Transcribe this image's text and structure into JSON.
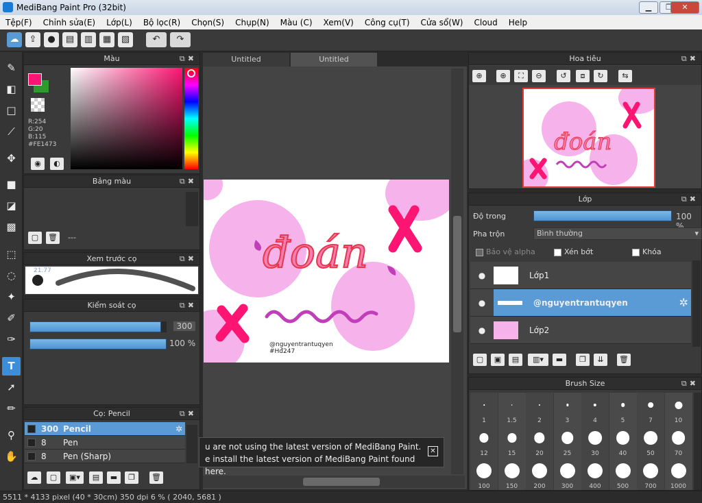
{
  "window": {
    "title": "MediBang Paint Pro (32bit)",
    "min": "▁",
    "max": "❐",
    "close": "✕"
  },
  "menu": [
    "Tệp(F)",
    "Chỉnh sửa(E)",
    "Lớp(L)",
    "Bộ lọc(R)",
    "Chọn(S)",
    "Chụp(N)",
    "Màu (C)",
    "Xem(V)",
    "Công cụ(T)",
    "Cửa sổ(W)",
    "Cloud",
    "Help"
  ],
  "color_panel": {
    "title": "Màu",
    "r": "R:254",
    "g": "G:20",
    "b": "B:115",
    "hex": "#FE1473",
    "fg": "#FE1473",
    "bg": "#2e9b2e"
  },
  "palette_panel": {
    "title": "Bảng màu",
    "none": "---"
  },
  "brush_preview": {
    "title": "Xem trước cọ",
    "size": "21.77"
  },
  "brush_control": {
    "title": "Kiểm soát cọ",
    "size_value": "300",
    "opacity_value": "100 %",
    "size_fraction": 0.96,
    "opacity_fraction": 1.0
  },
  "brush_list": {
    "title": "Cọ: Pencil",
    "items": [
      {
        "size": "300",
        "name": "Pencil"
      },
      {
        "size": "8",
        "name": "Pen"
      },
      {
        "size": "8",
        "name": "Pen (Sharp)"
      }
    ]
  },
  "tabs": [
    "Untitled",
    "Untitled"
  ],
  "artwork": {
    "word": "đoán",
    "credit_1": "@nguyentrantuqyen",
    "credit_2": "#Hđ247"
  },
  "notice": {
    "line1": "u are not using the latest version of MediBang Paint.",
    "line2": "e install the latest version of MediBang Paint found here.",
    "close": "✕"
  },
  "navigator": {
    "title": "Hoa tiêu"
  },
  "layer_panel": {
    "title": "Lớp",
    "opacity_label": "Độ trong",
    "opacity_value": "100 %",
    "opacity_fraction": 1.0,
    "blend_label": "Pha trộn",
    "blend_value": "Bình thường",
    "protect_alpha": "Bảo vệ alpha",
    "clip": "Xén bớt",
    "lock": "Khóa",
    "layers": [
      {
        "name": "Lớp1"
      },
      {
        "name": "@nguyentrantuqyen"
      },
      {
        "name": "Lớp2"
      }
    ]
  },
  "brush_size_panel": {
    "title": "Brush Size",
    "sizes": [
      "1",
      "1.5",
      "2",
      "3",
      "4",
      "5",
      "7",
      "10",
      "12",
      "15",
      "20",
      "25",
      "30",
      "40",
      "50",
      "70",
      "100",
      "150",
      "200",
      "300",
      "400",
      "500",
      "700",
      "1000"
    ]
  },
  "status": {
    "text": "5511 * 4133 pixel  (40 * 30cm)  350 dpi  6 %  ( 2040, 5681 )"
  },
  "colors": {
    "accent": "#5a9bd6",
    "pink": "#f6b2ea",
    "hotpink": "#fe1473"
  }
}
